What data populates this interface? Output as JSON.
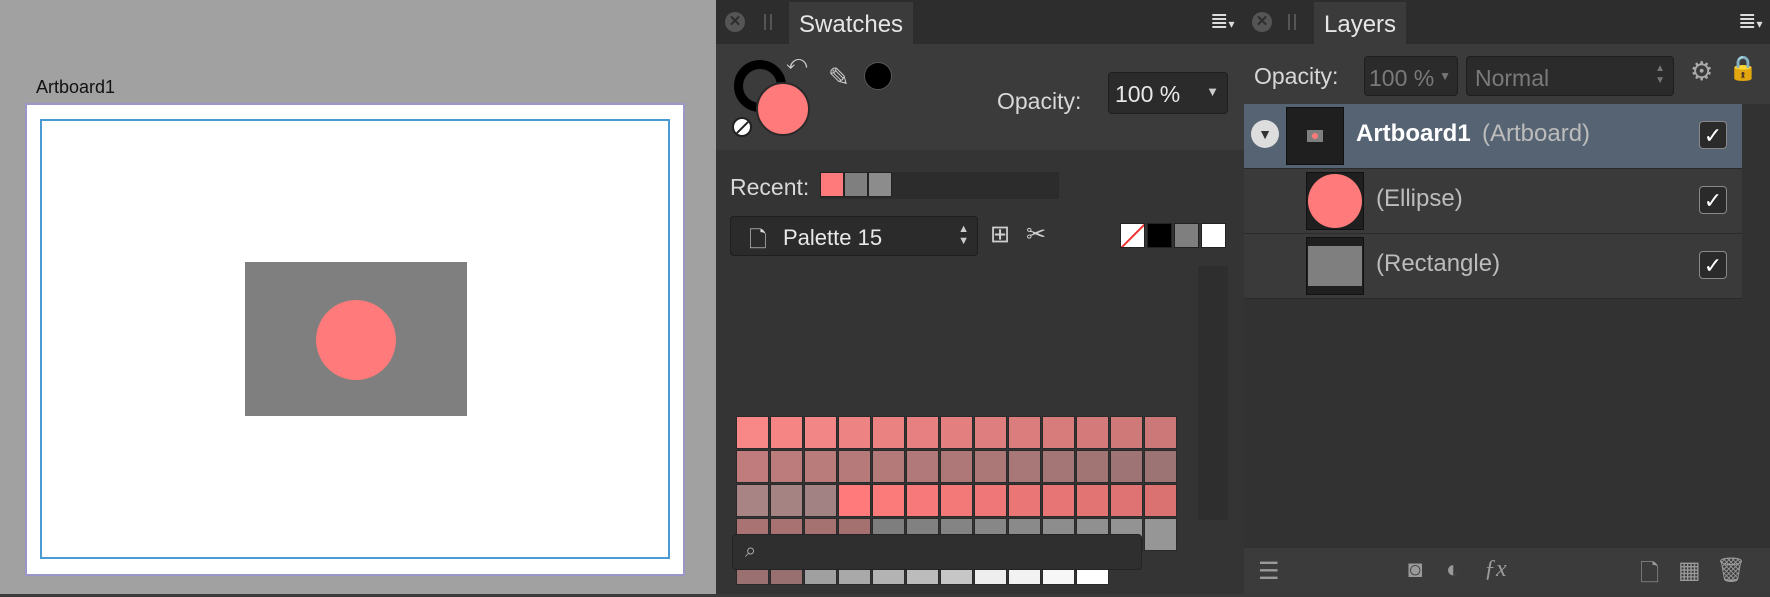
{
  "canvas": {
    "artboard_label": "Artboard1"
  },
  "swatches_panel": {
    "tab_label": "Swatches",
    "opacity_label": "Opacity:",
    "opacity_value": "100 %",
    "recent_label": "Recent:",
    "recent_colors": [
      "#ff7a7a",
      "#7f7f7f",
      "#8c8c8c"
    ],
    "palette_name": "Palette 15",
    "fill_color": "#ff7a7a",
    "stroke_color": "#000000",
    "quick_colors": [
      "none",
      "#000000",
      "#7f7f7f",
      "#ffffff"
    ],
    "swatch_rows": [
      [
        "#f88787",
        "#f58484",
        "#f28585",
        "#ee8383",
        "#eb8282",
        "#e78080",
        "#e37f7f",
        "#df7e7e",
        "#dc7d7d",
        "#d87b7b",
        "#d47a7a",
        "#d07979",
        "#cd7878"
      ],
      [
        "#c07c7c",
        "#bd7c7c",
        "#ba7b7b",
        "#b77a7a",
        "#b47a7a",
        "#b17979",
        "#ae7878",
        "#ab7777",
        "#a87777",
        "#a57676",
        "#a27575",
        "#9f7474",
        "#9c7474"
      ],
      [
        "#a88484",
        "#a58383",
        "#a28282",
        "#ff7b7b",
        "#fb7a7a",
        "#f77979",
        "#f37878",
        "#ef7777",
        "#eb7676",
        "#e77575",
        "#e37474",
        "#df7373",
        "#db7272"
      ],
      [
        "#aa7373",
        "#a87272",
        "#a67171",
        "#a47070",
        "#7e7e7e",
        "#818181",
        "#848484",
        "#878787",
        "#8a8a8a",
        "#8d8d8d",
        "#909090",
        "#939393",
        "#969696"
      ],
      [
        "#9a7070",
        "#987070",
        "#a0a0a0",
        "#a9a9a9",
        "#b3b3b3",
        "#bcbcbc",
        "#c6c6c6",
        "#eeeeee",
        "#f2f2f2",
        "#f7f7f7",
        "#ffffff"
      ]
    ],
    "search_placeholder": ""
  },
  "layers_panel": {
    "tab_label": "Layers",
    "opacity_label": "Opacity:",
    "opacity_value": "100 %",
    "blend_mode": "Normal",
    "layers": [
      {
        "name": "Artboard1",
        "type": "(Artboard)",
        "checked": "✓"
      },
      {
        "name": "",
        "type": "(Ellipse)",
        "checked": "✓"
      },
      {
        "name": "",
        "type": "(Rectangle)",
        "checked": "✓"
      }
    ]
  }
}
